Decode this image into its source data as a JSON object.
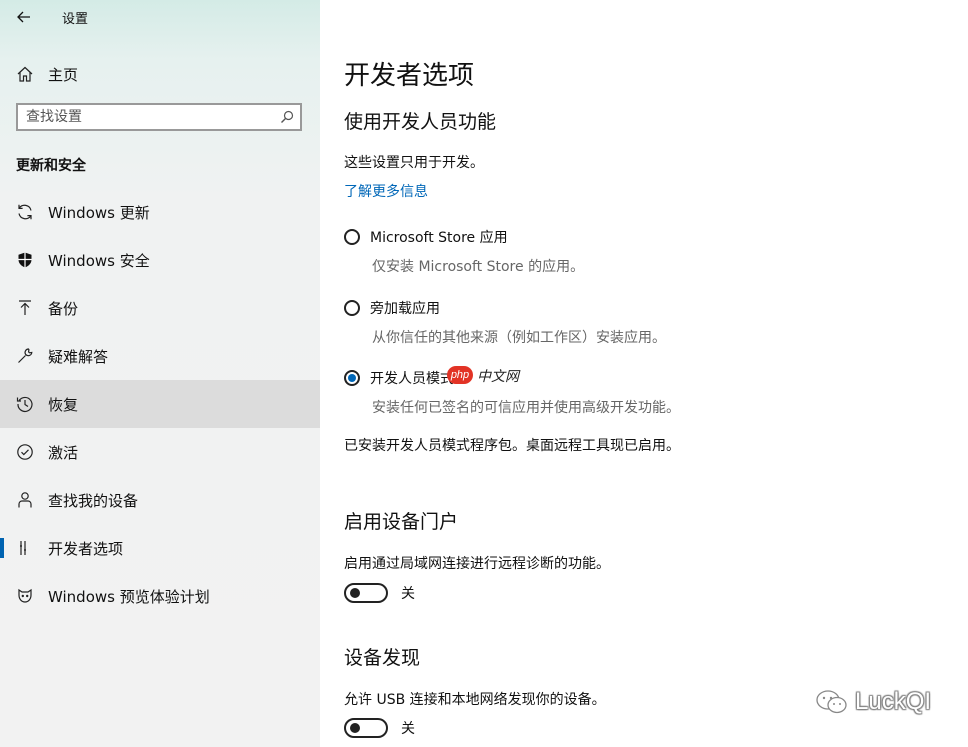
{
  "window": {
    "title": "设置"
  },
  "sidebar": {
    "home_label": "主页",
    "search": {
      "placeholder": "查找设置",
      "value": ""
    },
    "section_heading": "更新和安全",
    "items": [
      {
        "label": "Windows 更新",
        "icon": "sync-icon"
      },
      {
        "label": "Windows 安全",
        "icon": "shield-icon"
      },
      {
        "label": "备份",
        "icon": "backup-arrow-icon"
      },
      {
        "label": "疑难解答",
        "icon": "wrench-icon"
      },
      {
        "label": "恢复",
        "icon": "history-icon"
      },
      {
        "label": "激活",
        "icon": "check-circle-icon"
      },
      {
        "label": "查找我的设备",
        "icon": "person-icon"
      },
      {
        "label": "开发者选项",
        "icon": "developer-icon",
        "selected": true
      },
      {
        "label": "Windows 预览体验计划",
        "icon": "insider-icon"
      }
    ]
  },
  "main": {
    "title": "开发者选项",
    "developer_features": {
      "heading": "使用开发人员功能",
      "description": "这些设置只用于开发。",
      "learn_more": "了解更多信息",
      "options": [
        {
          "label": "Microsoft Store 应用",
          "description": "仅安装 Microsoft Store 的应用。",
          "selected": false
        },
        {
          "label": "旁加载应用",
          "description": "从你信任的其他来源（例如工作区）安装应用。",
          "selected": false
        },
        {
          "label": "开发人员模式",
          "description": "安装任何已签名的可信应用并使用高级开发功能。",
          "selected": true
        }
      ],
      "status": "已安装开发人员模式程序包。桌面远程工具现已启用。"
    },
    "device_portal": {
      "heading": "启用设备门户",
      "description": "启用通过局域网连接进行远程诊断的功能。",
      "toggle_state": "关"
    },
    "device_discovery": {
      "heading": "设备发现",
      "description": "允许 USB 连接和本地网络发现你的设备。",
      "toggle_state": "关"
    }
  },
  "watermarks": {
    "php_badge": "php",
    "php_site": "中文网",
    "luckqi": "LuckQI"
  },
  "colors": {
    "accent": "#0067b8",
    "selected_bg": "#dcdcdc",
    "indicator": "#0063b1"
  }
}
